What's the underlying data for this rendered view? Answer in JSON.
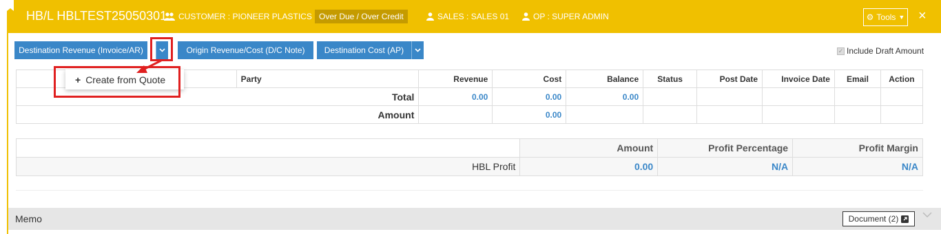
{
  "header": {
    "hbl_title": "HB/L HBLTEST25050301",
    "customer": "CUSTOMER : PIONEER PLASTICS",
    "overdue_badge": "Over Due / Over Credit",
    "sales": "SALES : SALES 01",
    "op": "OP : SUPER ADMIN",
    "tools_label": "Tools",
    "close_glyph": "×",
    "accent_color": "#f0c000"
  },
  "toolbar": {
    "dest_revenue_label": "Destination Revenue (Invoice/AR)",
    "origin_label": "Origin Revenue/Cost (D/C Note)",
    "dest_cost_label": "Destination Cost (AP)",
    "include_draft_label": "Include Draft Amount",
    "include_draft_checked": true,
    "button_color": "#3a87c8"
  },
  "dropdown_menu": {
    "create_from_quote_label": "Create from Quote",
    "plus_glyph": "+"
  },
  "charges_table": {
    "columns": [
      "",
      "Party",
      "Revenue",
      "Cost",
      "Balance",
      "Status",
      "Post Date",
      "Invoice Date",
      "Email",
      "Action"
    ],
    "total_label": "Total",
    "total_revenue": "0.00",
    "total_cost": "0.00",
    "total_balance": "0.00",
    "amount_label": "Amount",
    "amount_cost": "0.00"
  },
  "profit_table": {
    "amount_header": "Amount",
    "profit_percentage_header": "Profit Percentage",
    "profit_margin_header": "Profit Margin",
    "row_label": "HBL Profit",
    "amount_value": "0.00",
    "percentage_value": "N/A",
    "margin_value": "N/A"
  },
  "memo": {
    "label": "Memo",
    "document_button": "Document (2)"
  },
  "highlight_color": "#e02020"
}
